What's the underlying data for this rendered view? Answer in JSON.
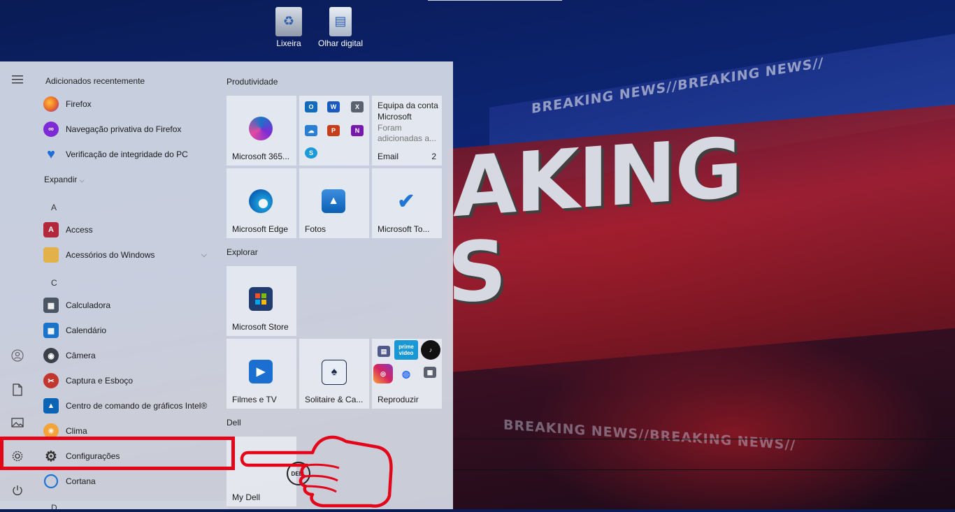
{
  "desktop": {
    "icons": [
      {
        "label": "Lixeira",
        "icon": "recycle-bin-icon"
      },
      {
        "label": "Olhar digital",
        "icon": "document-icon"
      }
    ],
    "wallpaper": {
      "big_text_1": "AKING",
      "big_text_2": "S",
      "strip_1": "BREAKING NEWS//BREAKING NEWS//",
      "strip_2": "BREAKING NEWS//BREAKING NEWS//"
    }
  },
  "start_menu": {
    "rail": {
      "menu_icon": "hamburger-icon",
      "user_icon": "user-icon",
      "documents_icon": "document-icon",
      "pictures_icon": "pictures-icon",
      "settings_icon": "gear-icon",
      "power_icon": "power-icon"
    },
    "recently_added_header": "Adicionados recentemente",
    "recent": [
      {
        "label": "Firefox",
        "icon": "firefox-icon",
        "color": "#e8662a"
      },
      {
        "label": "Navegação privativa do Firefox",
        "icon": "private-mask-icon",
        "color": "#7d2bd6"
      },
      {
        "label": "Verificação de integridade do PC",
        "icon": "heart-pulse-icon",
        "color": "#1e6ed6"
      }
    ],
    "expand_label": "Expandir",
    "sections": [
      {
        "letter": "A",
        "apps": [
          {
            "label": "Access",
            "icon": "access-icon",
            "color": "#b3283a"
          },
          {
            "label": "Acessórios do Windows",
            "icon": "folder-icon",
            "color": "#e2b14a",
            "has_chevron": true
          }
        ]
      },
      {
        "letter": "C",
        "apps": [
          {
            "label": "Calculadora",
            "icon": "calculator-icon",
            "color": "#4b5563"
          },
          {
            "label": "Calendário",
            "icon": "calendar-icon",
            "color": "#1a73c8"
          },
          {
            "label": "Câmera",
            "icon": "camera-icon",
            "color": "#3a3f48"
          },
          {
            "label": "Captura e Esboço",
            "icon": "snip-icon",
            "color": "#c2362f"
          },
          {
            "label": "Centro de comando de gráficos Intel®",
            "icon": "intel-icon",
            "color": "#0b63b6"
          },
          {
            "label": "Clima",
            "icon": "weather-icon",
            "color": "#f0a43a"
          },
          {
            "label": "Configurações",
            "icon": "gear-icon",
            "color": "#444",
            "selected": true
          },
          {
            "label": "Cortana",
            "icon": "cortana-icon",
            "color": "#1f74d4"
          }
        ]
      },
      {
        "letter": "D",
        "apps": []
      }
    ],
    "tiles": {
      "groups": [
        {
          "title": "Produtividade"
        },
        {
          "title": "Explorar"
        },
        {
          "title": "Dell"
        }
      ],
      "m365": {
        "label": "Microsoft 365...",
        "icon": "microsoft365-icon"
      },
      "office_grid": [
        "outlook-icon",
        "word-icon",
        "excel-icon",
        "onedrive-icon",
        "powerpoint-icon",
        "onenote-icon",
        "skype-icon"
      ],
      "mail": {
        "title": "Equipa da conta Microsoft",
        "subtitle": "Foram adicionadas a...",
        "label": "Email",
        "count": "2"
      },
      "edge": {
        "label": "Microsoft Edge",
        "icon": "edge-icon"
      },
      "photos": {
        "label": "Fotos",
        "icon": "photos-icon"
      },
      "todo": {
        "label": "Microsoft To...",
        "icon": "todo-check-icon"
      },
      "store": {
        "label": "Microsoft Store",
        "icon": "store-bag-icon"
      },
      "movies": {
        "label": "Filmes e TV",
        "icon": "play-icon"
      },
      "solitaire": {
        "label": "Solitaire & Ca...",
        "icon": "cards-icon"
      },
      "play": {
        "label": "Reproduzir",
        "icons": [
          "news-icon",
          "prime-video-icon",
          "tiktok-icon",
          "instagram-icon",
          "messenger-icon",
          "calculator-icon"
        ],
        "prime_text_1": "prime",
        "prime_text_2": "video"
      },
      "mydell": {
        "label": "My Dell",
        "icon": "dell-logo-icon",
        "logo_text": "DELL"
      }
    }
  },
  "annotation": {
    "highlight_color": "#e3061a",
    "pointer": "pointing-hand-icon"
  }
}
